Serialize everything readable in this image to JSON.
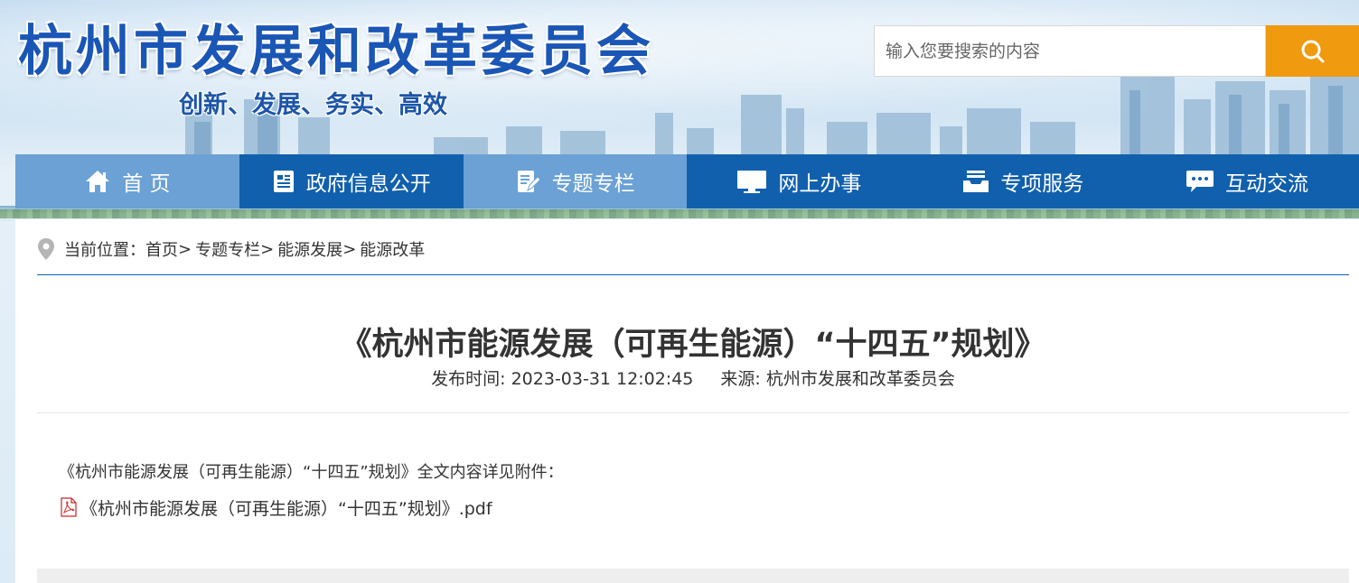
{
  "header": {
    "site_title": "杭州市发展和改革委员会",
    "slogan": "创新、发展、务实、高效",
    "search": {
      "placeholder": "输入您要搜索的内容",
      "button_icon": "search-icon"
    }
  },
  "nav": {
    "items": [
      {
        "label": "首 页",
        "icon": "home-icon"
      },
      {
        "label": "政府信息公开",
        "icon": "document-icon"
      },
      {
        "label": "专题专栏",
        "icon": "edit-note-icon"
      },
      {
        "label": "网上办事",
        "icon": "monitor-icon"
      },
      {
        "label": "专项服务",
        "icon": "inbox-tray-icon"
      },
      {
        "label": "互动交流",
        "icon": "chat-bubble-icon"
      }
    ],
    "colors": {
      "primary": "#1160ad",
      "highlight": "#6ba1d4"
    }
  },
  "breadcrumb": {
    "prefix": "当前位置：",
    "items": [
      "首页",
      "专题专栏",
      "能源发展",
      "能源改革"
    ],
    "separator": ">"
  },
  "article": {
    "title": "《杭州市能源发展（可再生能源）“十四五”规划》",
    "publish_label": "发布时间: 2023-03-31 12:02:45",
    "source_label": "来源: 杭州市发展和改革委员会",
    "intro": "《杭州市能源发展（可再生能源）“十四五”规划》全文内容详见附件：",
    "attachment": "《杭州市能源发展（可再生能源）“十四五”规划》.pdf"
  },
  "colors": {
    "search_button": "#f09a10",
    "title_blue": "#1a56b5",
    "rule": "#1160ad"
  }
}
